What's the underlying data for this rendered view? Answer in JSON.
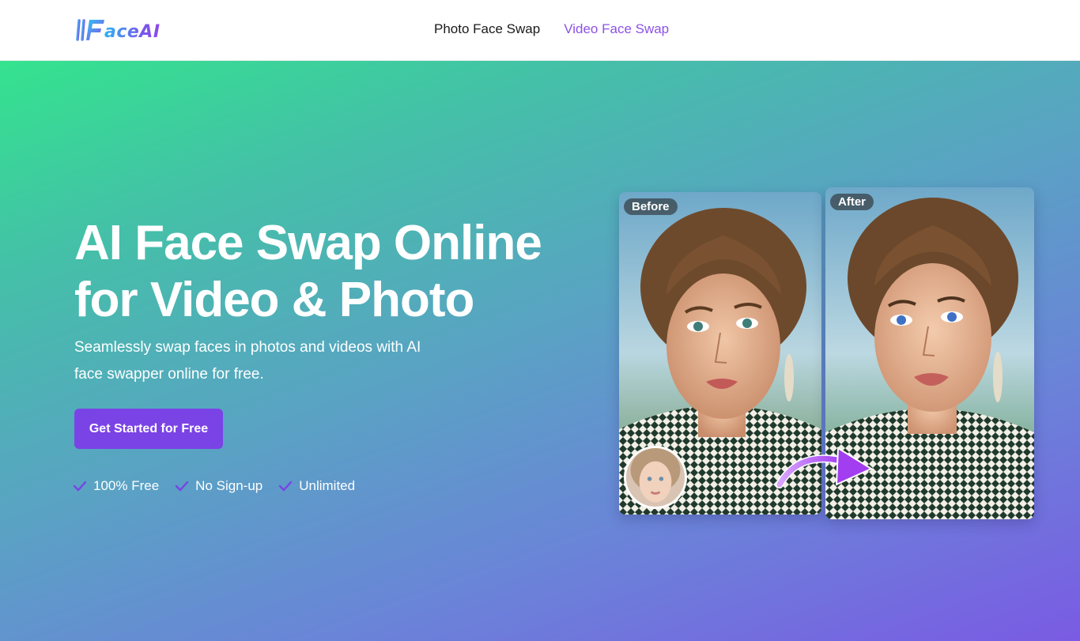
{
  "header": {
    "logo_text": "aceAI",
    "nav": [
      {
        "label": "Photo Face Swap",
        "active": false
      },
      {
        "label": "Video Face Swap",
        "active": true
      }
    ]
  },
  "hero": {
    "title": "AI Face Swap Online for Video & Photo",
    "subtitle": "Seamlessly swap faces in photos and videos with AI face swapper online for free.",
    "cta_label": "Get Started for Free",
    "features": [
      "100% Free",
      "No Sign-up",
      "Unlimited"
    ],
    "before_label": "Before",
    "after_label": "After"
  },
  "colors": {
    "accent": "#7a43e6",
    "nav_active": "#8c52e6",
    "gradient_top": "#34e38e",
    "gradient_bottom": "#7a5be3"
  },
  "icons": {
    "check": "check-icon",
    "arrow": "curved-arrow-icon"
  }
}
